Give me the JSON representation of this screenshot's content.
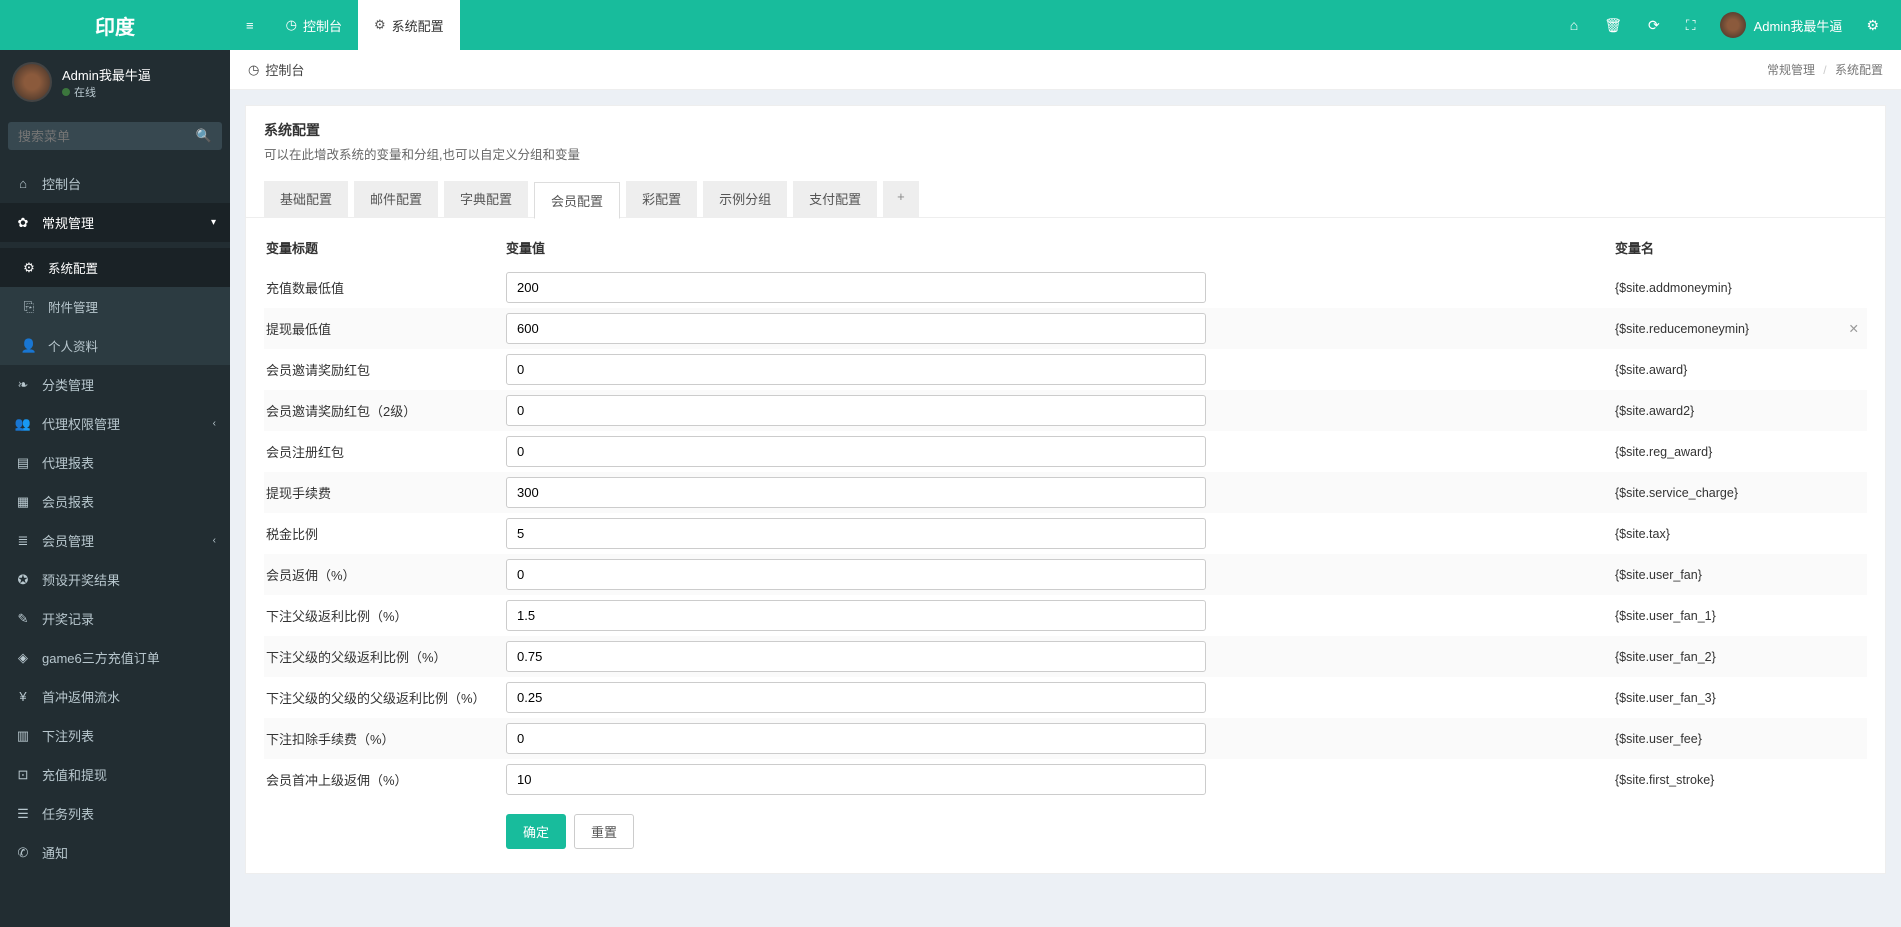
{
  "brand": "印度",
  "user": {
    "name": "Admin我最牛逼",
    "status": "在线"
  },
  "search": {
    "placeholder": "搜索菜单"
  },
  "topnav": {
    "toggle": "≡",
    "console": "控制台",
    "sysconfig": "系统配置"
  },
  "breadcrumb": {
    "console_icon_label": "控制台",
    "group": "常规管理",
    "page": "系统配置"
  },
  "panel": {
    "title": "系统配置",
    "desc": "可以在此增改系统的变量和分组,也可以自定义分组和变量"
  },
  "tabs": [
    "基础配置",
    "邮件配置",
    "字典配置",
    "会员配置",
    "彩配置",
    "示例分组",
    "支付配置"
  ],
  "active_tab_index": 3,
  "table_head": {
    "title": "变量标题",
    "value": "变量值",
    "name": "变量名"
  },
  "rows": [
    {
      "title": "充值数最低值",
      "value": "200",
      "name": "{$site.addmoneymin}"
    },
    {
      "title": "提现最低值",
      "value": "600",
      "name": "{$site.reducemoneymin}",
      "removable": true
    },
    {
      "title": "会员邀请奖励红包",
      "value": "0",
      "name": "{$site.award}"
    },
    {
      "title": "会员邀请奖励红包（2级）",
      "value": "0",
      "name": "{$site.award2}"
    },
    {
      "title": "会员注册红包",
      "value": "0",
      "name": "{$site.reg_award}"
    },
    {
      "title": "提现手续费",
      "value": "300",
      "name": "{$site.service_charge}"
    },
    {
      "title": "税金比例",
      "value": "5",
      "name": "{$site.tax}"
    },
    {
      "title": "会员返佣（%）",
      "value": "0",
      "name": "{$site.user_fan}"
    },
    {
      "title": "下注父级返利比例（%）",
      "value": "1.5",
      "name": "{$site.user_fan_1}"
    },
    {
      "title": "下注父级的父级返利比例（%）",
      "value": "0.75",
      "name": "{$site.user_fan_2}"
    },
    {
      "title": "下注父级的父级的父级返利比例（%）",
      "value": "0.25",
      "name": "{$site.user_fan_3}"
    },
    {
      "title": "下注扣除手续费（%）",
      "value": "0",
      "name": "{$site.user_fee}"
    },
    {
      "title": "会员首冲上级返佣（%）",
      "value": "10",
      "name": "{$site.first_stroke}"
    }
  ],
  "buttons": {
    "ok": "确定",
    "reset": "重置"
  },
  "sidemenu": [
    {
      "icon": "⌂",
      "label": "控制台"
    },
    {
      "icon": "✿",
      "label": "常规管理",
      "open": true,
      "children": [
        {
          "icon": "⚙",
          "label": "系统配置",
          "active": true
        },
        {
          "icon": "⎘",
          "label": "附件管理"
        },
        {
          "icon": "👤",
          "label": "个人资料"
        }
      ]
    },
    {
      "icon": "❧",
      "label": "分类管理"
    },
    {
      "icon": "👥",
      "label": "代理权限管理",
      "arrow": true
    },
    {
      "icon": "▤",
      "label": "代理报表"
    },
    {
      "icon": "▦",
      "label": "会员报表"
    },
    {
      "icon": "≣",
      "label": "会员管理",
      "arrow": true
    },
    {
      "icon": "✪",
      "label": "预设开奖结果"
    },
    {
      "icon": "✎",
      "label": "开奖记录"
    },
    {
      "icon": "◈",
      "label": "game6三方充值订单"
    },
    {
      "icon": "¥",
      "label": "首冲返佣流水"
    },
    {
      "icon": "▥",
      "label": "下注列表"
    },
    {
      "icon": "⊡",
      "label": "充值和提现"
    },
    {
      "icon": "☰",
      "label": "任务列表"
    },
    {
      "icon": "✆",
      "label": "通知"
    }
  ]
}
